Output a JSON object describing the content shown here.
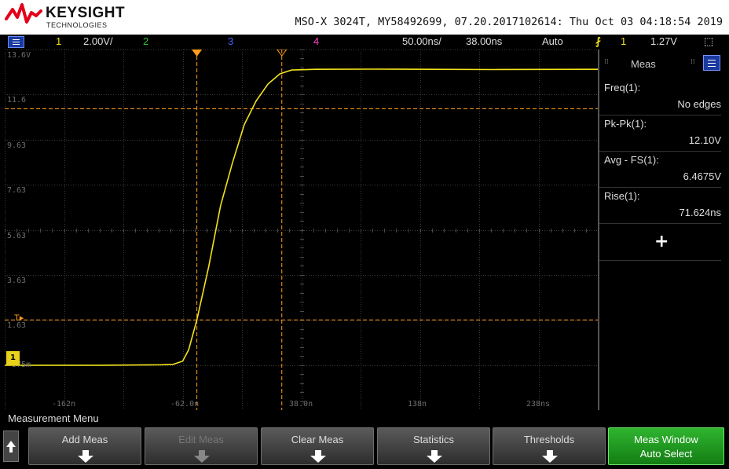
{
  "header": {
    "brand_name": "KEYSIGHT",
    "brand_sub": "TECHNOLOGIES",
    "instrument_info": "MSO-X 3024T, MY58492699, 07.20.2017102614: Thu Oct 03 04:18:54 2019"
  },
  "status_bar": {
    "ch1_num": "1",
    "ch1_scale": "2.00V/",
    "ch2_num": "2",
    "ch3_num": "3",
    "ch4_num": "4",
    "timebase": "50.00ns/",
    "delay": "38.00ns",
    "trigger_mode": "Auto",
    "trigger_source": "1",
    "trigger_level": "1.27V"
  },
  "grid": {
    "y_labels": [
      "13.6V",
      "11.6",
      "9.63",
      "7.63",
      "5.63",
      "3.63",
      "1.63",
      "-375m"
    ],
    "x_labels": [
      "-162n",
      "-62.0n",
      "38.0n",
      "138n",
      "238ns"
    ],
    "ground_marker": "1",
    "trigger_marker": "T"
  },
  "chart_data": {
    "type": "line",
    "title": "",
    "xlabel": "",
    "ylabel": "",
    "xlim_ns": [
      -212,
      288
    ],
    "ylim_v": [
      -2.37,
      13.63
    ],
    "series": [
      {
        "color": "#f2e21b",
        "points": [
          [
            -212,
            -0.38
          ],
          [
            -130,
            -0.38
          ],
          [
            -100,
            -0.37
          ],
          [
            -80,
            -0.36
          ],
          [
            -70,
            -0.34
          ],
          [
            -62,
            -0.2
          ],
          [
            -57,
            0.3
          ],
          [
            -50,
            1.63
          ],
          [
            -40,
            4.0
          ],
          [
            -30,
            6.7
          ],
          [
            -20,
            8.6
          ],
          [
            -10,
            10.3
          ],
          [
            0,
            11.35
          ],
          [
            10,
            12.1
          ],
          [
            20,
            12.55
          ],
          [
            30,
            12.72
          ],
          [
            50,
            12.75
          ],
          [
            100,
            12.76
          ],
          [
            200,
            12.74
          ],
          [
            288,
            12.75
          ]
        ]
      }
    ],
    "cursors": {
      "x1_ns": -50.0,
      "x2_ns": 21.6,
      "y1_v": 1.63,
      "y2_v": 11.0
    },
    "grid": true
  },
  "meas_panel": {
    "title": "Meas",
    "items": [
      {
        "label": "Freq(1):",
        "value": "No edges"
      },
      {
        "label": "Pk-Pk(1):",
        "value": "12.10V"
      },
      {
        "label": "Avg - FS(1):",
        "value": "6.4675V"
      },
      {
        "label": "Rise(1):",
        "value": "71.624ns"
      }
    ],
    "add_symbol": "+"
  },
  "softkeys": {
    "menu_title": "Measurement Menu",
    "add_meas": "Add Meas",
    "edit_meas": "Edit Meas",
    "clear_meas": "Clear Meas",
    "statistics": "Statistics",
    "thresholds": "Thresholds",
    "meas_window_line1": "Meas Window",
    "meas_window_line2": "Auto Select"
  },
  "colors": {
    "channel1": "#f2e21b",
    "channel2": "#2ec22e",
    "channel3": "#4a64ff",
    "channel4": "#ff3fd0",
    "cursor": "#ff9d1c",
    "active_softkey": "#1f9a1f"
  }
}
